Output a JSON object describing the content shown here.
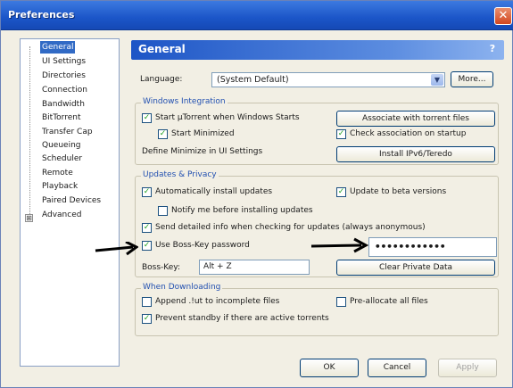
{
  "window": {
    "title": "Preferences",
    "close_glyph": "✕"
  },
  "tree": {
    "items": [
      {
        "label": "General",
        "selected": true
      },
      {
        "label": "UI Settings"
      },
      {
        "label": "Directories"
      },
      {
        "label": "Connection"
      },
      {
        "label": "Bandwidth"
      },
      {
        "label": "BitTorrent"
      },
      {
        "label": "Transfer Cap"
      },
      {
        "label": "Queueing"
      },
      {
        "label": "Scheduler"
      },
      {
        "label": "Remote"
      },
      {
        "label": "Playback"
      },
      {
        "label": "Paired Devices"
      },
      {
        "label": "Advanced",
        "expander": "⊞"
      }
    ]
  },
  "header": {
    "title": "General",
    "help": "?"
  },
  "language": {
    "label": "Language:",
    "value": "(System Default)",
    "more_button": "More..."
  },
  "windows_integration": {
    "title": "Windows Integration",
    "start_with_windows": "Start µTorrent when Windows Starts",
    "start_minimized": "Start Minimized",
    "define_minimize": "Define Minimize in UI Settings",
    "associate_button": "Associate with torrent files",
    "check_association": "Check association on startup",
    "install_ipv6_button": "Install IPv6/Teredo"
  },
  "updates": {
    "title": "Updates & Privacy",
    "auto_install": "Automatically install updates",
    "beta_versions": "Update to beta versions",
    "notify_before": "Notify me before installing updates",
    "send_info": "Send detailed info when checking for updates (always anonymous)",
    "boss_key_password": "Use Boss-Key password",
    "password_value": "••••••••••••",
    "boss_key_label": "Boss-Key:",
    "boss_key_value": "Alt + Z",
    "clear_private_button": "Clear Private Data"
  },
  "downloading": {
    "title": "When Downloading",
    "append_ut": "Append .!ut to incomplete files",
    "preallocate": "Pre-allocate all files",
    "prevent_standby": "Prevent standby if there are active torrents"
  },
  "footer": {
    "ok": "OK",
    "cancel": "Cancel",
    "apply": "Apply"
  },
  "colors": {
    "title_bar": "#1b55c8",
    "header": "#1d55c6",
    "check_mark": "#21a121",
    "group_label": "#2250b0"
  }
}
